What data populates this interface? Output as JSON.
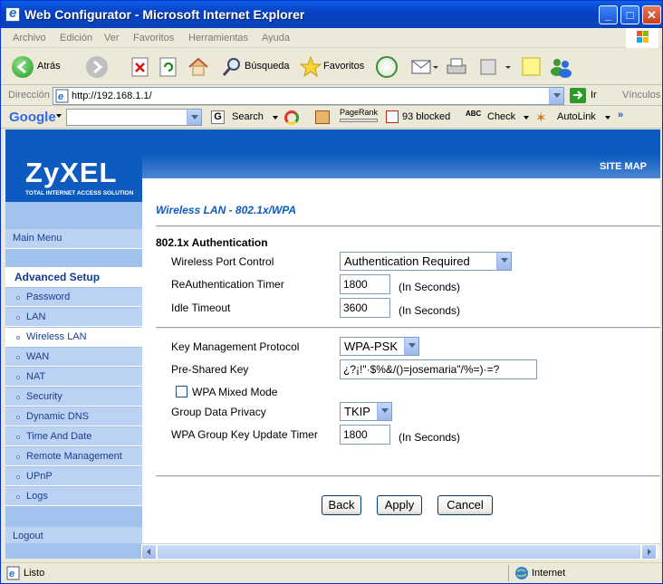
{
  "window": {
    "title": "Web Configurator - Microsoft Internet Explorer"
  },
  "menu": [
    "Archivo",
    "Edición",
    "Ver",
    "Favoritos",
    "Herramientas",
    "Ayuda"
  ],
  "toolbar": {
    "back": "Atrás",
    "search": "Búsqueda",
    "favorites": "Favoritos"
  },
  "address": {
    "label": "Dirección",
    "url": "http://192.168.1.1/",
    "go": "Ir",
    "links": "Vínculos"
  },
  "google": {
    "logo": "Google",
    "search": "Search",
    "pagerank": "PageRank",
    "blocked": "93 blocked",
    "check": "Check",
    "autolink": "AutoLink"
  },
  "brand": {
    "name": "ZyXEL",
    "tagline": "Total Internet Access Solution",
    "sitemap": "SITE MAP"
  },
  "sidebar": {
    "main_menu": "Main Menu",
    "advanced": "Advanced Setup",
    "items": [
      "Password",
      "LAN",
      "Wireless LAN",
      "WAN",
      "NAT",
      "Security",
      "Dynamic DNS",
      "Time And Date",
      "Remote Management",
      "UPnP",
      "Logs"
    ],
    "logout": "Logout"
  },
  "page": {
    "title": "Wireless LAN - 802.1x/WPA",
    "section": "802.1x Authentication",
    "port_control": {
      "label": "Wireless Port Control",
      "value": "Authentication Required"
    },
    "reauth": {
      "label": "ReAuthentication Timer",
      "value": "1800",
      "unit": "(In Seconds)"
    },
    "idle": {
      "label": "Idle Timeout",
      "value": "3600",
      "unit": "(In Seconds)"
    },
    "kmp": {
      "label": "Key Management Protocol",
      "value": "WPA-PSK"
    },
    "psk": {
      "label": "Pre-Shared Key",
      "value": "¿?¡!\"·$%&/()=josemaria\"/%=)·=?"
    },
    "mixed": {
      "label": "WPA Mixed Mode",
      "checked": false
    },
    "gdp": {
      "label": "Group Data Privacy",
      "value": "TKIP"
    },
    "gkut": {
      "label": "WPA Group Key Update Timer",
      "value": "1800",
      "unit": "(In Seconds)"
    },
    "buttons": {
      "back": "Back",
      "apply": "Apply",
      "cancel": "Cancel"
    }
  },
  "status": {
    "left": "Listo",
    "zone": "Internet"
  }
}
